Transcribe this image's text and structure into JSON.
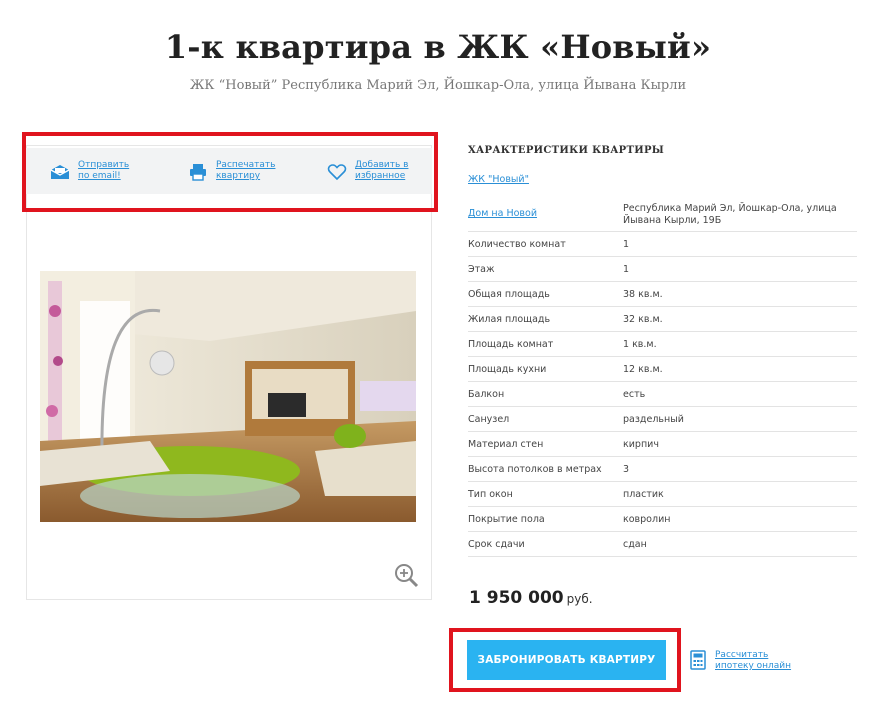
{
  "page": {
    "title": "1-к квартира в ЖК «Новый»",
    "subtitle": "ЖК “Новый” Республика Марий Эл, Йошкар-Ола, улица Йывана Кырли"
  },
  "actions": [
    {
      "label": "Отправить по email!",
      "icon": "email-icon"
    },
    {
      "label": "Распечатать квартиру",
      "icon": "printer-icon"
    },
    {
      "label": "Добавить в избранное",
      "icon": "heart-icon"
    }
  ],
  "specs": {
    "heading": "ХАРАКТЕРИСТИКИ КВАРТИРЫ",
    "complex_link": "ЖК \"Новый\"",
    "address_key": "Дом на Новой",
    "address_value": "Республика Марий Эл, Йошкар-Ола, улица Йывана Кырли, 19Б",
    "rows": [
      {
        "k": "Количество комнат",
        "v": "1"
      },
      {
        "k": "Этаж",
        "v": "1"
      },
      {
        "k": "Общая площадь",
        "v": "38 кв.м."
      },
      {
        "k": "Жилая площадь",
        "v": "32 кв.м."
      },
      {
        "k": "Площадь комнат",
        "v": "1 кв.м."
      },
      {
        "k": "Площадь кухни",
        "v": "12 кв.м."
      },
      {
        "k": "Балкон",
        "v": "есть"
      },
      {
        "k": "Санузел",
        "v": "раздельный"
      },
      {
        "k": "Материал стен",
        "v": "кирпич"
      },
      {
        "k": "Высота потолков в метрах",
        "v": "3"
      },
      {
        "k": "Тип окон",
        "v": "пластик"
      },
      {
        "k": "Покрытие пола",
        "v": "ковролин"
      },
      {
        "k": "Срок сдачи",
        "v": "сдан"
      }
    ]
  },
  "price": {
    "amount": "1 950 000",
    "currency": "руб."
  },
  "book_button": "ЗАБРОНИРОВАТЬ КВАРТИРУ",
  "mortgage_link": "Рассчитать ипотеку онлайн",
  "colors": {
    "accent": "#2ab3f1",
    "link": "#2a8fd6",
    "highlight": "#e0141e"
  }
}
